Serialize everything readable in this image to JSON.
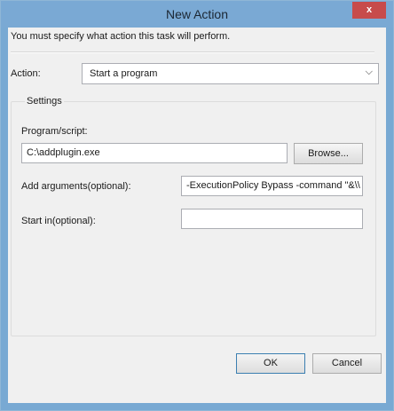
{
  "window": {
    "title": "New Action",
    "close_glyph": "x"
  },
  "intro_text": "You must specify what action this task will perform.",
  "action": {
    "label": "Action:",
    "value": "Start a program",
    "dropdown_icon": "chevron-down-icon"
  },
  "settings": {
    "group_title": "Settings",
    "program_label": "Program/script:",
    "program_value": "C:\\addplugin.exe",
    "browse_label": "Browse...",
    "arguments_label": "Add arguments(optional):",
    "arguments_value": "-ExecutionPolicy Bypass -command \"&\\\\",
    "start_in_label": "Start in(optional):",
    "start_in_value": ""
  },
  "buttons": {
    "ok": "OK",
    "cancel": "Cancel"
  }
}
